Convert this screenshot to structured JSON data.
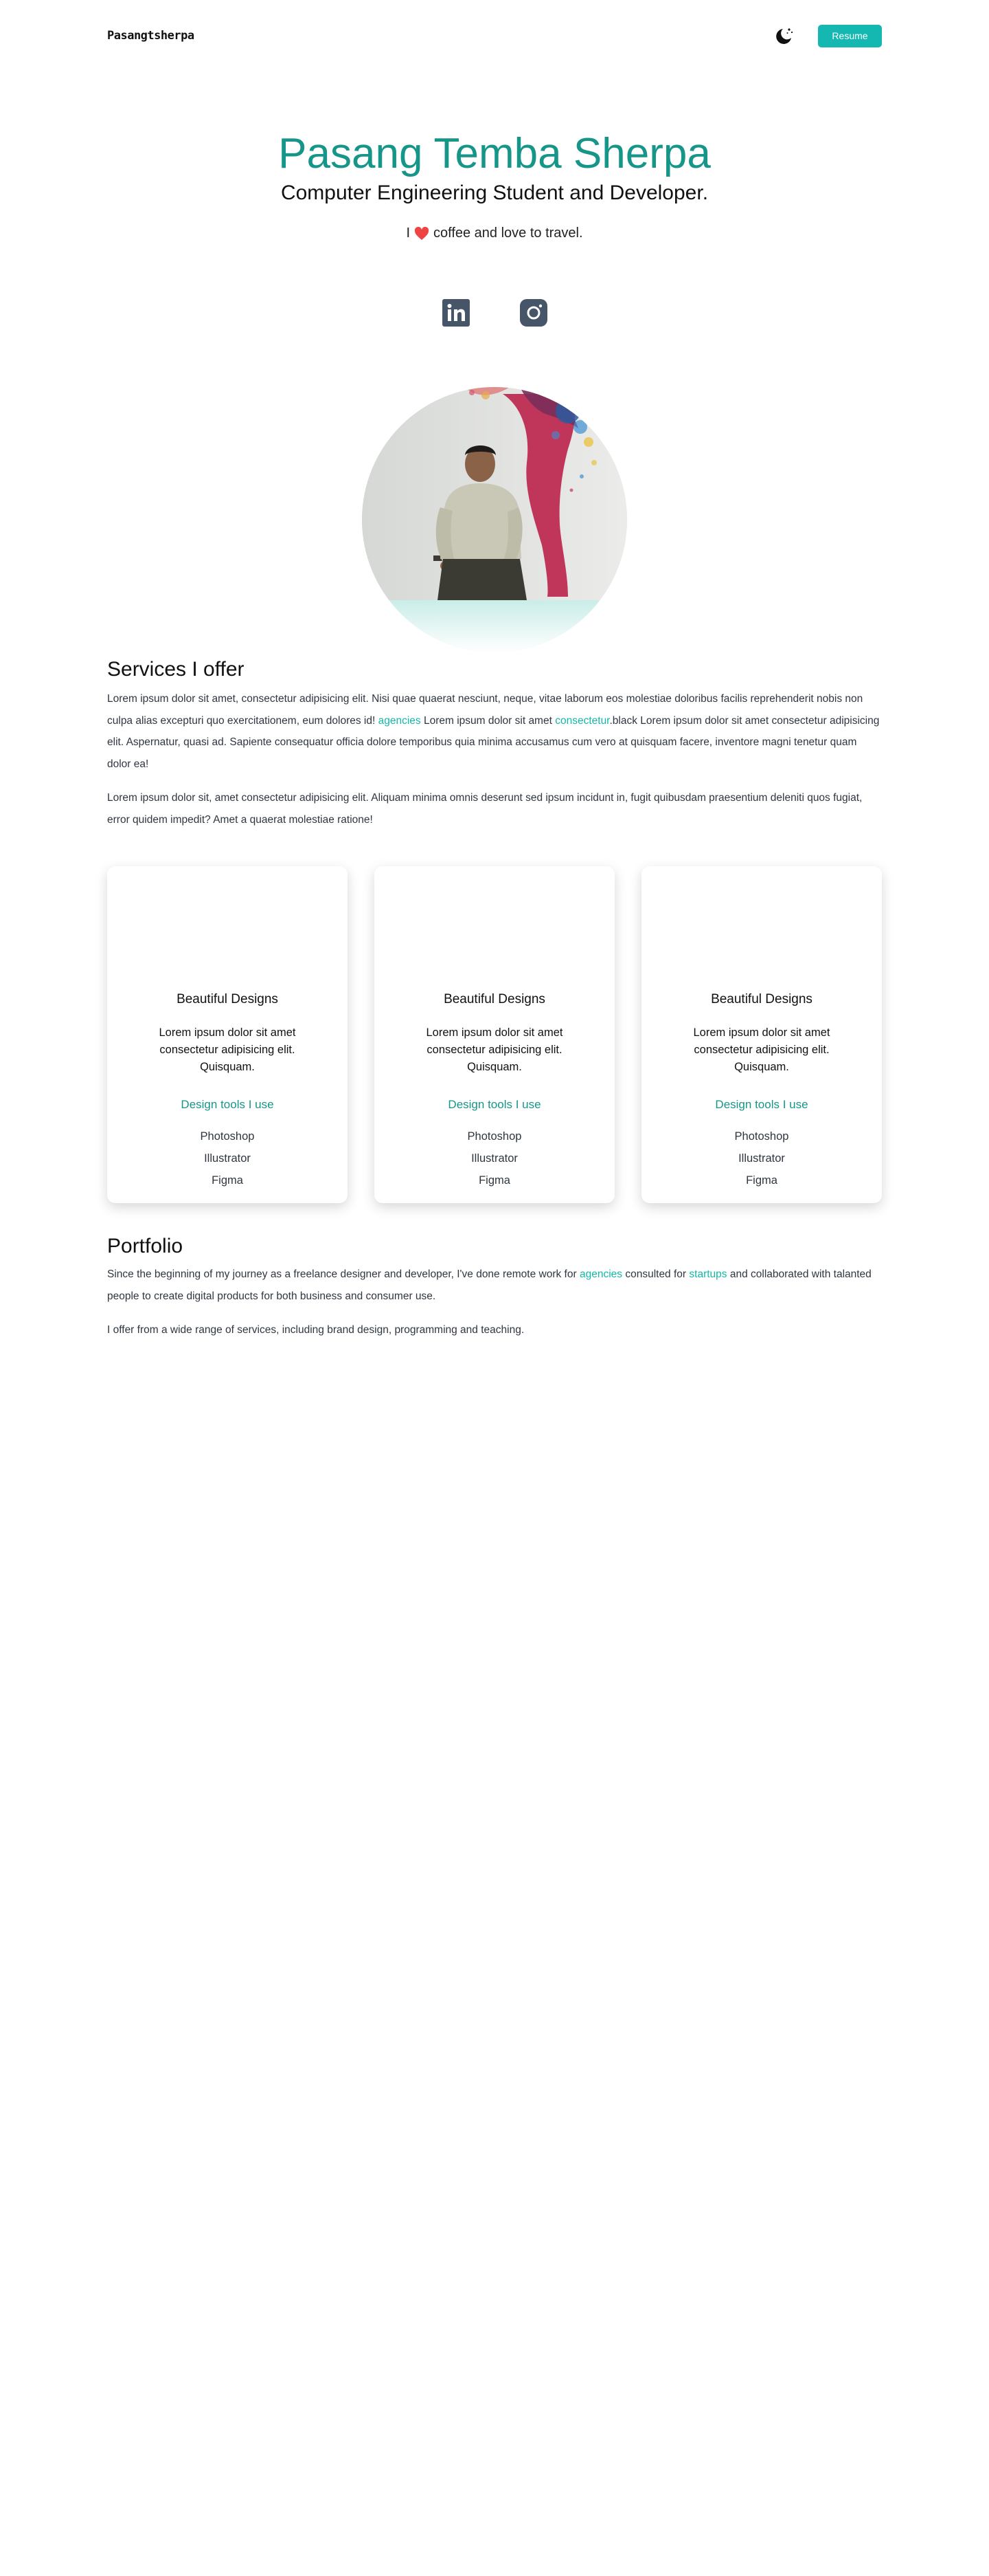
{
  "nav": {
    "logo": "Pasangtsherpa",
    "theme_toggle_icon": "moon-icon",
    "resume_label": "Resume"
  },
  "hero": {
    "name": "Pasang Temba Sherpa",
    "subtitle": "Computer Engineering Student and Developer.",
    "tagline_prefix": "I",
    "tagline_suffix": "coffee and love to travel.",
    "heart_icon": "heart-icon"
  },
  "socials": [
    {
      "icon": "linkedin-icon",
      "label": "LinkedIn"
    },
    {
      "icon": "instagram-icon",
      "label": "Instagram"
    }
  ],
  "services": {
    "title": "Services I offer",
    "p1_part1": "Lorem ipsum dolor sit amet, consectetur adipisicing elit. Nisi quae quaerat nesciunt, neque, vitae laborum eos molestiae doloribus facilis reprehenderit nobis non culpa alias excepturi quo exercitationem, eum dolores id!",
    "p1_link1": "agencies",
    "p1_part2": "Lorem ipsum dolor sit amet",
    "p1_link2": "consectetur",
    "p1_part3": ".black Lorem ipsum dolor sit amet consectetur adipisicing elit. Aspernatur, quasi ad. Sapiente consequatur officia dolore temporibus quia minima accusamus cum vero at quisquam facere, inventore magni tenetur quam dolor ea!",
    "p2": "Lorem ipsum dolor sit, amet consectetur adipisicing elit. Aliquam minima omnis deserunt sed ipsum incidunt in, fugit quibusdam praesentium deleniti quos fugiat, error quidem impedit? Amet a quaerat molestiae ratione!"
  },
  "cards": [
    {
      "title": "Beautiful Designs",
      "desc": "Lorem ipsum dolor sit amet consectetur adipisicing elit. Quisquam.",
      "tools_title": "Design tools I use",
      "tools": [
        "Photoshop",
        "Illustrator",
        "Figma"
      ]
    },
    {
      "title": "Beautiful Designs",
      "desc": "Lorem ipsum dolor sit amet consectetur adipisicing elit. Quisquam.",
      "tools_title": "Design tools I use",
      "tools": [
        "Photoshop",
        "Illustrator",
        "Figma"
      ]
    },
    {
      "title": "Beautiful Designs",
      "desc": "Lorem ipsum dolor sit amet consectetur adipisicing elit. Quisquam.",
      "tools_title": "Design tools I use",
      "tools": [
        "Photoshop",
        "Illustrator",
        "Figma"
      ]
    }
  ],
  "portfolio": {
    "title": "Portfolio",
    "p1_part1": "Since the beginning of my journey as a freelance designer and developer, I've done remote work for",
    "p1_link1": "agencies",
    "p1_part2": "consulted for",
    "p1_link2": "startups",
    "p1_part3": "and collaborated with talanted people to create digital products for both business and consumer use.",
    "p2": "I offer from a wide range of services, including brand design, programming and teaching."
  },
  "colors": {
    "accent": "#169688",
    "button": "#14b8b0",
    "link": "#14b8a6",
    "heart": "#ef4444",
    "icon_dark": "#475569"
  }
}
